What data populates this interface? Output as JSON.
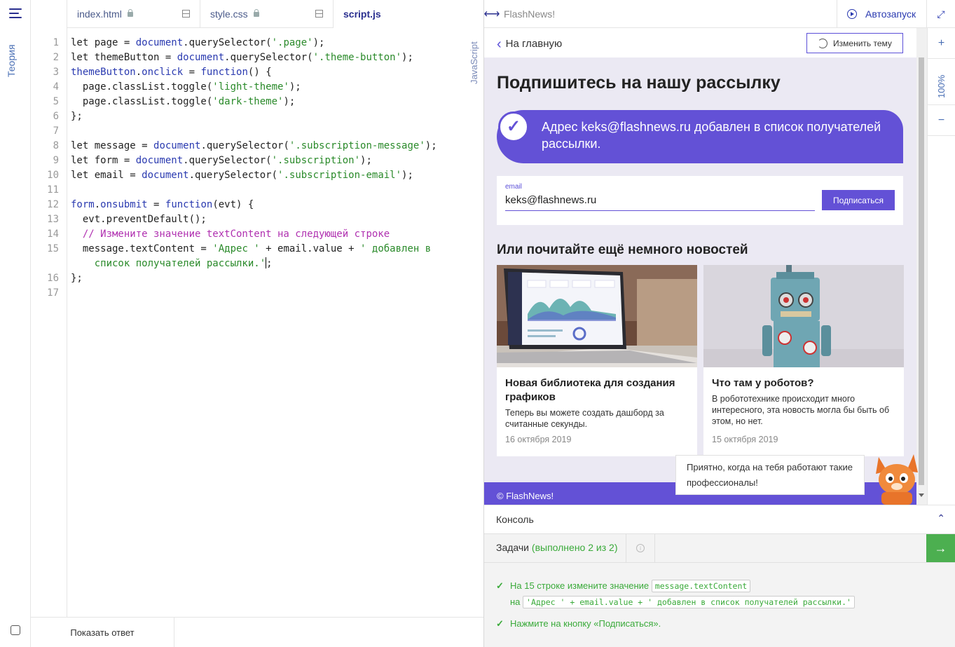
{
  "editor": {
    "tabs": [
      {
        "label": "index.html",
        "locked": true
      },
      {
        "label": "style.css",
        "locked": true
      },
      {
        "label": "script.js",
        "locked": false,
        "active": true
      }
    ],
    "language_label": "JavaScript",
    "sidebar_theory_label": "Теория",
    "show_answer_label": "Показать ответ",
    "lines": [
      {
        "n": "1",
        "html": "let page = <span class='f'>document</span>.querySelector(<span class='s'>'.page'</span>);"
      },
      {
        "n": "2",
        "html": "let themeButton = <span class='f'>document</span>.querySelector(<span class='s'>'.theme-button'</span>);"
      },
      {
        "n": "3",
        "html": "<span class='k'>themeButton</span>.<span class='k'>onclick</span> = <span class='k'>function</span>() {"
      },
      {
        "n": "4",
        "html": "  page.classList.toggle(<span class='s'>'light-theme'</span>);"
      },
      {
        "n": "5",
        "html": "  page.classList.toggle(<span class='s'>'dark-theme'</span>);"
      },
      {
        "n": "6",
        "html": "};"
      },
      {
        "n": "7",
        "html": ""
      },
      {
        "n": "8",
        "html": "let message = <span class='f'>document</span>.querySelector(<span class='s'>'.subscription-message'</span>);"
      },
      {
        "n": "9",
        "html": "let form = <span class='f'>document</span>.querySelector(<span class='s'>'.subscription'</span>);"
      },
      {
        "n": "10",
        "html": "let email = <span class='f'>document</span>.querySelector(<span class='s'>'.subscription-email'</span>);"
      },
      {
        "n": "11",
        "html": ""
      },
      {
        "n": "12",
        "html": "<span class='k'>form</span>.<span class='k'>onsubmit</span> = <span class='k'>function</span>(evt) {"
      },
      {
        "n": "13",
        "html": "  evt.preventDefault();"
      },
      {
        "n": "14",
        "html": "  <span class='c'>// Измените значение textContent на следующей строке</span>"
      },
      {
        "n": "15",
        "html": "  message.textContent = <span class='s'>'Адрес '</span> + email.value + <span class='s'>' добавлен в</span>"
      },
      {
        "n": "",
        "html": "    <span class='s'>список получателей рассылки.'</span><span class='cursor'></span>;"
      },
      {
        "n": "16",
        "html": "};"
      },
      {
        "n": "17",
        "html": ""
      }
    ]
  },
  "preview": {
    "window_title": "FlashNews!",
    "autorun_label": "Автозапуск",
    "zoom": "100%",
    "back_label": "На главную",
    "theme_button": "Изменить тему",
    "heading": "Подпишитесь на нашу рассылку",
    "message": "Адрес keks@flashnews.ru добавлен в список получателей рассылки.",
    "email_label": "email",
    "email_value": "keks@flashnews.ru",
    "subscribe_button": "Подписаться",
    "news_heading": "Или почитайте ещё немного новостей",
    "cards": [
      {
        "title": "Новая библиотека для создания графиков",
        "desc": "Теперь вы можете создать дашборд за считанные секунды.",
        "date": "16 октября 2019"
      },
      {
        "title": "Что там у роботов?",
        "desc": "В робототехнике происходит много интересного, эта новость могла бы быть об этом, но нет.",
        "date": "15 октября 2019"
      }
    ],
    "footer": "© FlashNews!",
    "tooltip": "Приятно, когда на тебя работают такие профессионалы!"
  },
  "console": {
    "label": "Консоль"
  },
  "tasks": {
    "label": "Задачи",
    "progress": "(выполнено 2 из 2)",
    "task1_prefix": "На 15 строке измените значение",
    "task1_code1": "message.textContent",
    "task1_mid": "на",
    "task1_code2": "'Адрес ' + email.value + ' добавлен в список получателей рассылки.'",
    "task2": "Нажмите на кнопку «Подписаться»."
  },
  "colors": {
    "accent": "#6351d6",
    "success": "#4caf50",
    "nav": "#2a2f8f"
  }
}
